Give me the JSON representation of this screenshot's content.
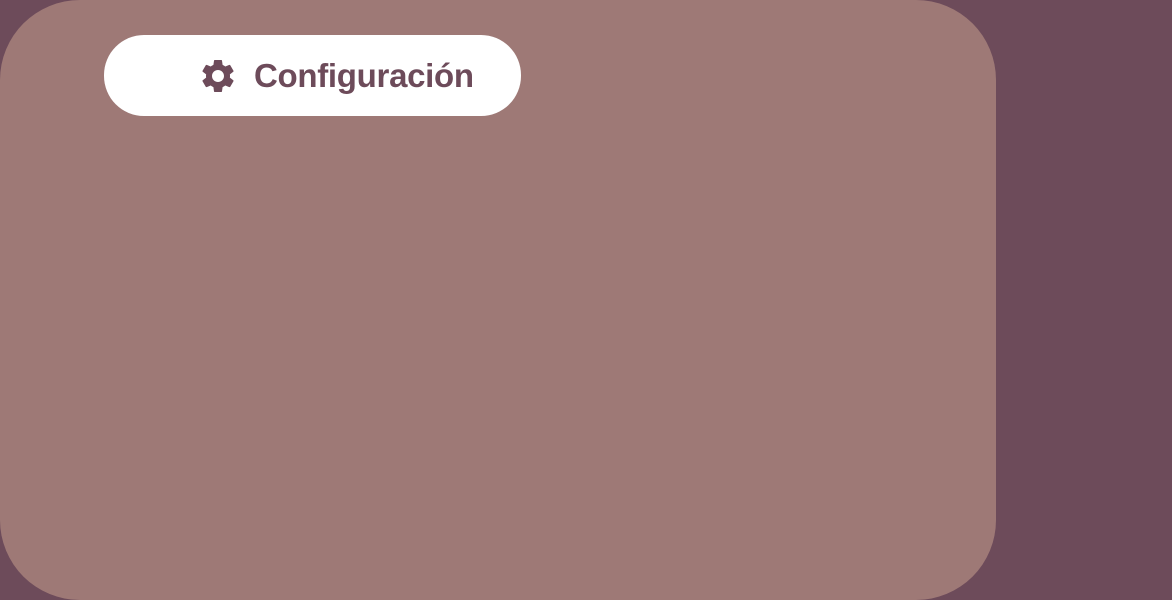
{
  "colors": {
    "background": "#6d4b5a",
    "panel": "#9e7976",
    "pill": "#ffffff",
    "accent": "#6d4b5a"
  },
  "settings_button": {
    "icon": "gear-icon",
    "label": "Configuración"
  }
}
